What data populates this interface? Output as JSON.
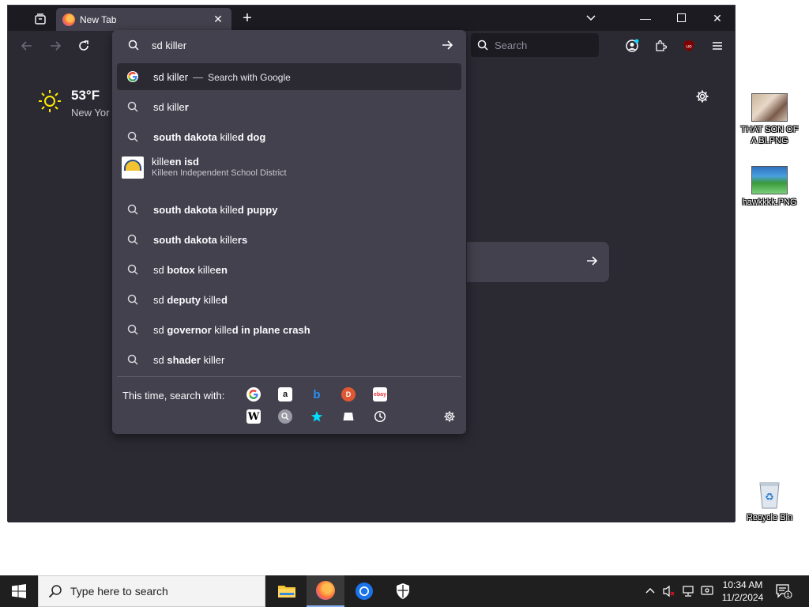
{
  "browser": {
    "tab_title": "New Tab",
    "search_placeholder": "Search"
  },
  "newtab": {
    "temperature": "53°F",
    "city": "New Yor"
  },
  "urlbar": {
    "query": "sd killer",
    "results": [
      {
        "parts": [
          {
            "t": "sd killer",
            "b": false
          }
        ],
        "suffix_sep": "—",
        "suffix": "Search with Google"
      },
      {
        "parts": [
          {
            "t": "sd kille",
            "b": false
          },
          {
            "t": "r",
            "b": true
          }
        ]
      },
      {
        "parts": [
          {
            "t": "south dakota",
            "b": true
          },
          {
            "t": " kille",
            "b": false
          },
          {
            "t": "d dog",
            "b": true
          }
        ]
      },
      {
        "parts": [
          {
            "t": "kille",
            "b": false
          },
          {
            "t": "en isd",
            "b": true
          }
        ],
        "description": "Killeen Independent School District"
      },
      {
        "parts": [
          {
            "t": "south dakota",
            "b": true
          },
          {
            "t": " kille",
            "b": false
          },
          {
            "t": "d puppy",
            "b": true
          }
        ]
      },
      {
        "parts": [
          {
            "t": "south dakota",
            "b": true
          },
          {
            "t": " kille",
            "b": false
          },
          {
            "t": "rs",
            "b": true
          }
        ]
      },
      {
        "parts": [
          {
            "t": "sd ",
            "b": false
          },
          {
            "t": "botox",
            "b": true
          },
          {
            "t": " kille",
            "b": false
          },
          {
            "t": "en",
            "b": true
          }
        ]
      },
      {
        "parts": [
          {
            "t": "sd ",
            "b": false
          },
          {
            "t": "deputy",
            "b": true
          },
          {
            "t": " kille",
            "b": false
          },
          {
            "t": "d",
            "b": true
          }
        ]
      },
      {
        "parts": [
          {
            "t": "sd ",
            "b": false
          },
          {
            "t": "governor",
            "b": true
          },
          {
            "t": " kille",
            "b": false
          },
          {
            "t": "d in plane crash",
            "b": true
          }
        ]
      },
      {
        "parts": [
          {
            "t": "sd ",
            "b": false
          },
          {
            "t": "shader",
            "b": true
          },
          {
            "t": " killer",
            "b": false
          }
        ]
      }
    ],
    "oneoff_label": "This time, search with:",
    "engines": [
      "google",
      "amazon",
      "bing",
      "duckduckgo",
      "ebay",
      "wikipedia",
      "search-engine",
      "bookmarks",
      "tabs",
      "history"
    ]
  },
  "desktop": {
    "icons": [
      {
        "label": "THAT SON OF A BI.PNG"
      },
      {
        "label": "hawkkkk.PNG"
      },
      {
        "label": "Recycle Bin"
      }
    ]
  },
  "taskbar": {
    "search_placeholder": "Type here to search",
    "time": "10:34 AM",
    "date": "11/2/2024",
    "notification_count": "1"
  }
}
